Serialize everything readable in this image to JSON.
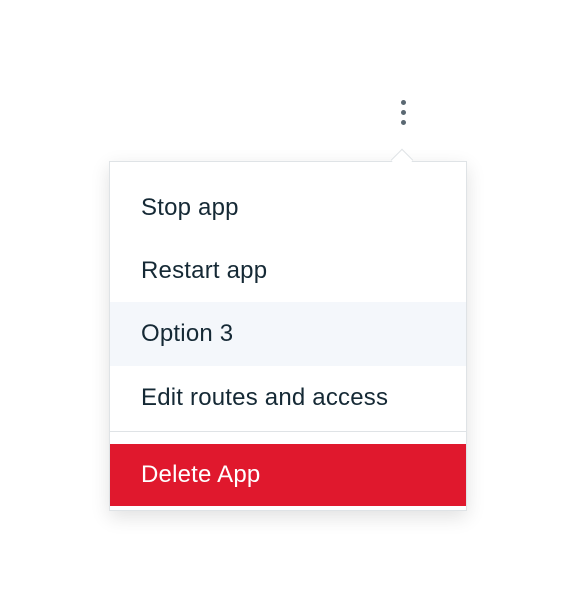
{
  "overflow_menu": {
    "trigger_icon": "overflow-menu-vertical-icon",
    "items": [
      {
        "label": "Stop app"
      },
      {
        "label": "Restart app"
      },
      {
        "label": "Option 3",
        "state": "hover"
      },
      {
        "label": "Edit routes and access"
      }
    ],
    "danger_item": {
      "label": "Delete App"
    }
  },
  "colors": {
    "icon": "#5a6872",
    "text": "#152935",
    "hover_bg": "#f4f7fb",
    "danger_bg": "#e0182d",
    "border": "#dfe3e6"
  }
}
